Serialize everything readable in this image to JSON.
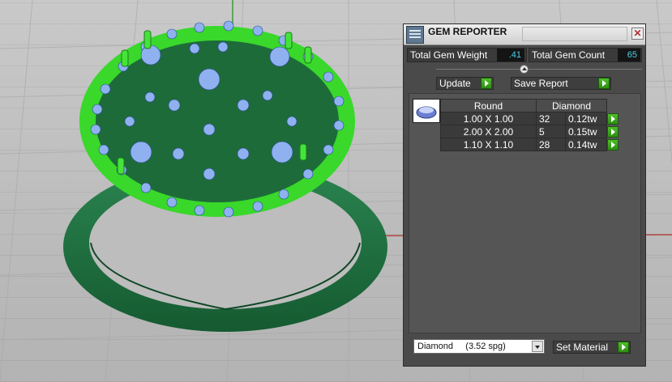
{
  "viewport": {
    "model": "ring-with-pave-gems",
    "colors": {
      "metal": "#1f6b3c",
      "selected_metal": "#3fe02e",
      "gem": "#8fb1ef",
      "background": "#bdbdbd",
      "axis_red": "#b0453f"
    }
  },
  "gem_reporter": {
    "title": "GEM REPORTER",
    "total_weight_label": "Total Gem Weight",
    "total_weight_value": ".41",
    "total_count_label": "Total Gem Count",
    "total_count_value": "65",
    "update_label": "Update",
    "save_report_label": "Save Report",
    "table": {
      "headers": [
        "Round",
        "Diamond"
      ],
      "rows": [
        {
          "size": "1.00 X 1.00",
          "count": "32",
          "weight": "0.12tw"
        },
        {
          "size": "2.00 X 2.00",
          "count": "5",
          "weight": "0.15tw"
        },
        {
          "size": "1.10 X 1.10",
          "count": "28",
          "weight": "0.14tw"
        }
      ]
    },
    "material_selected": "Diamond     (3.52 spg)",
    "set_material_label": "Set Material",
    "accent_go": "#3aa51d"
  }
}
